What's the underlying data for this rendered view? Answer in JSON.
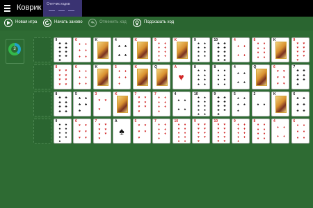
{
  "app": {
    "title": "Коврик"
  },
  "header": {
    "moves_label": "Счетчик ходов"
  },
  "toolbar": {
    "new_game": "Новая игра",
    "restart": "Начать заново",
    "undo": "Отменить ход",
    "hint": "Подсказать ход"
  },
  "stock": {
    "count": "3"
  },
  "colors": {
    "felt": "#2e6b33",
    "accent": "#3a3372",
    "red_suit": "#d12727"
  },
  "board": {
    "rows": [
      [
        {
          "rank": "",
          "suit": ""
        },
        {
          "rank": "9",
          "suit": "♣",
          "color": "black"
        },
        {
          "rank": "6",
          "suit": "♦",
          "color": "red"
        },
        {
          "rank": "K",
          "suit": "♣",
          "color": "black"
        },
        {
          "rank": "4",
          "suit": "♣",
          "color": "black"
        },
        {
          "rank": "K",
          "suit": "♦",
          "color": "red"
        },
        {
          "rank": "9",
          "suit": "♦",
          "color": "red"
        },
        {
          "rank": "K",
          "suit": "♦",
          "color": "red"
        },
        {
          "rank": "9",
          "suit": "♠",
          "color": "black"
        },
        {
          "rank": "10",
          "suit": "♣",
          "color": "black"
        },
        {
          "rank": "4",
          "suit": "♦",
          "color": "red"
        },
        {
          "rank": "8",
          "suit": "♦",
          "color": "red"
        },
        {
          "rank": "K",
          "suit": "♠",
          "color": "black"
        },
        {
          "rank": "9",
          "suit": "♥",
          "color": "red"
        }
      ],
      [
        {
          "rank": "",
          "suit": ""
        },
        {
          "rank": "8",
          "suit": "♥",
          "color": "red"
        },
        {
          "rank": "6",
          "suit": "♦",
          "color": "red"
        },
        {
          "rank": "K",
          "suit": "♣",
          "color": "black"
        },
        {
          "rank": "5",
          "suit": "♦",
          "color": "red"
        },
        {
          "rank": "K",
          "suit": "♥",
          "color": "red"
        },
        {
          "rank": "Q",
          "suit": "♠",
          "color": "black"
        },
        {
          "rank": "A",
          "suit": "♥",
          "color": "red"
        },
        {
          "rank": "8",
          "suit": "♠",
          "color": "black"
        },
        {
          "rank": "8",
          "suit": "♠",
          "color": "black"
        },
        {
          "rank": "4",
          "suit": "♠",
          "color": "black"
        },
        {
          "rank": "Q",
          "suit": "♣",
          "color": "black"
        },
        {
          "rank": "6",
          "suit": "♥",
          "color": "red"
        },
        {
          "rank": "7",
          "suit": "♣",
          "color": "black"
        }
      ],
      [
        {
          "rank": "",
          "suit": ""
        },
        {
          "rank": "8",
          "suit": "♣",
          "color": "black"
        },
        {
          "rank": "5",
          "suit": "♣",
          "color": "black"
        },
        {
          "rank": "3",
          "suit": "♥",
          "color": "red"
        },
        {
          "rank": "K",
          "suit": "♥",
          "color": "red"
        },
        {
          "rank": "7",
          "suit": "♥",
          "color": "red"
        },
        {
          "rank": "7",
          "suit": "♦",
          "color": "red"
        },
        {
          "rank": "4",
          "suit": "♠",
          "color": "black"
        },
        {
          "rank": "10",
          "suit": "♠",
          "color": "black"
        },
        {
          "rank": "9",
          "suit": "♣",
          "color": "black"
        },
        {
          "rank": "5",
          "suit": "♠",
          "color": "black"
        },
        {
          "rank": "2",
          "suit": "♠",
          "color": "black"
        },
        {
          "rank": "K",
          "suit": "♣",
          "color": "black"
        },
        {
          "rank": "6",
          "suit": "♣",
          "color": "black"
        }
      ],
      [
        {
          "rank": "",
          "suit": ""
        },
        {
          "rank": "9",
          "suit": "♠",
          "color": "black"
        },
        {
          "rank": "6",
          "suit": "♥",
          "color": "red"
        },
        {
          "rank": "7",
          "suit": "♥",
          "color": "red"
        },
        {
          "rank": "A",
          "suit": "♠",
          "color": "black"
        },
        {
          "rank": "5",
          "suit": "♥",
          "color": "red"
        },
        {
          "rank": "7",
          "suit": "♦",
          "color": "red"
        },
        {
          "rank": "10",
          "suit": "♦",
          "color": "red"
        },
        {
          "rank": "9",
          "suit": "♥",
          "color": "red"
        },
        {
          "rank": "10",
          "suit": "♥",
          "color": "red"
        },
        {
          "rank": "9",
          "suit": "♦",
          "color": "red"
        },
        {
          "rank": "8",
          "suit": "♦",
          "color": "red"
        },
        {
          "rank": "4",
          "suit": "♦",
          "color": "red"
        },
        {
          "rank": "6",
          "suit": "♦",
          "color": "red"
        }
      ]
    ]
  }
}
